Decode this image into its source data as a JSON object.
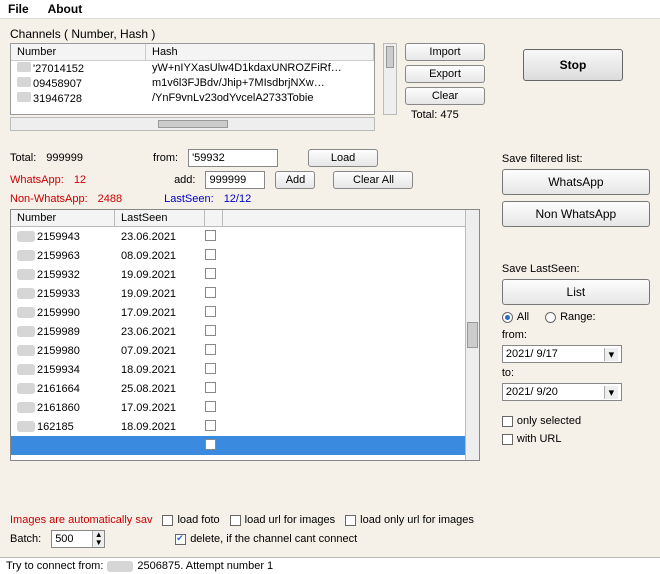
{
  "menu": {
    "file": "File",
    "about": "About"
  },
  "channels": {
    "title": "Channels ( Number, Hash )",
    "headers": {
      "number": "Number",
      "hash": "Hash"
    },
    "rows": [
      {
        "num": "'27014152",
        "hash": "yW+nIYXasUlw4D1kdaxUNROZFiRf…"
      },
      {
        "num": "09458907",
        "hash": "m1v6l3FJBdv/Jhip+7MIsdbrjNXw…"
      },
      {
        "num": "31946728",
        "hash": "/YnF9vnLv23odYvcelA2733Tobie"
      }
    ],
    "import": "Import",
    "export": "Export",
    "clear": "Clear",
    "total": "Total: 475"
  },
  "stop": "Stop",
  "stats": {
    "total_lbl": "Total:",
    "total_val": "999999",
    "from_lbl": "from:",
    "from_val": "'59932",
    "wa_lbl": "WhatsApp:",
    "wa_val": "12",
    "add_lbl": "add:",
    "add_val": "999999",
    "add_btn": "Add",
    "nonwa_lbl": "Non-WhatsApp:",
    "nonwa_val": "2488",
    "ls_lbl": "LastSeen:",
    "ls_val": "12/12",
    "load": "Load",
    "clearall": "Clear All"
  },
  "numlist": {
    "headers": {
      "number": "Number",
      "lastseen": "LastSeen"
    },
    "rows": [
      {
        "num": "2159943",
        "seen": "23.06.2021"
      },
      {
        "num": "2159963",
        "seen": "08.09.2021"
      },
      {
        "num": "2159932",
        "seen": "19.09.2021"
      },
      {
        "num": "2159933",
        "seen": "19.09.2021"
      },
      {
        "num": "2159990",
        "seen": "17.09.2021"
      },
      {
        "num": "2159989",
        "seen": "23.06.2021"
      },
      {
        "num": "2159980",
        "seen": "07.09.2021"
      },
      {
        "num": "2159934",
        "seen": "18.09.2021"
      },
      {
        "num": "2161664",
        "seen": "25.08.2021"
      },
      {
        "num": "2161860",
        "seen": "17.09.2021"
      },
      {
        "num": "162185",
        "seen": "18.09.2021"
      }
    ]
  },
  "right": {
    "save_filtered": "Save filtered list:",
    "wa_btn": "WhatsApp",
    "nonwa_btn": "Non WhatsApp",
    "save_ls": "Save LastSeen:",
    "list_btn": "List",
    "all": "All",
    "range": "Range:",
    "from": "from:",
    "from_val": "2021/ 9/17",
    "to": "to:",
    "to_val": "2021/ 9/20",
    "only_sel": "only selected",
    "with_url": "with URL"
  },
  "bottom": {
    "auto_save": "Images are automatically sav",
    "load_foto": "load foto",
    "load_url_img": "load url for images",
    "load_only_url": "load only url for images",
    "delete_cant": "delete, if the channel cant connect",
    "batch_lbl": "Batch:",
    "batch_val": "500"
  },
  "status": {
    "prefix": "Try to connect from:",
    "suffix": "2506875. Attempt number 1"
  }
}
